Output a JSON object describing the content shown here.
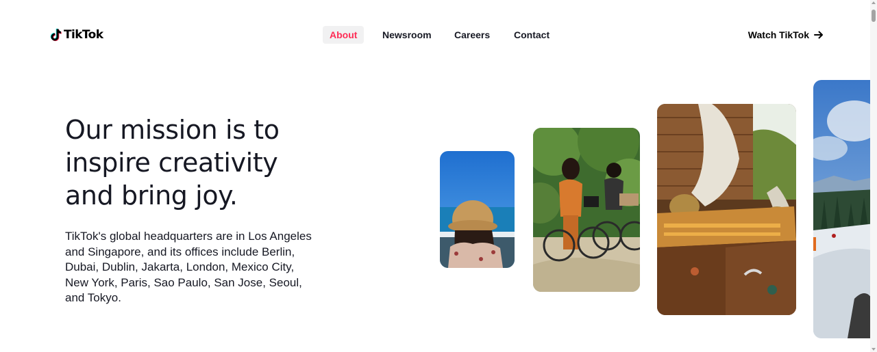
{
  "header": {
    "logo_text": "TikTok",
    "nav": {
      "about": "About",
      "newsroom": "Newsroom",
      "careers": "Careers",
      "contact": "Contact"
    },
    "watch_label": "Watch TikTok"
  },
  "hero": {
    "headline": "Our mission is to inspire creativity and bring joy.",
    "body": "TikTok's global headquarters are in Los Angeles and Singapore, and its offices include Berlin, Dubai, Dublin, Jakarta, London, Mexico City, New York, Paris, Sao Paulo, San Jose, Seoul, and Tokyo."
  },
  "colors": {
    "accent": "#fe2c55",
    "text": "#161823",
    "nav_active_bg": "#f1f1f2"
  },
  "icons": {
    "logo": "tiktok-logo-icon",
    "watch_arrow": "arrow-right-icon"
  }
}
